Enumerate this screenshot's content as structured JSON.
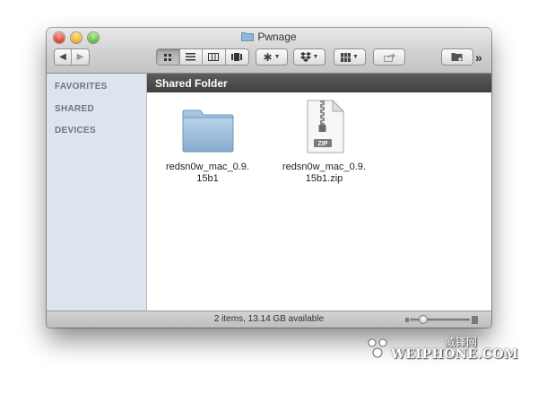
{
  "window": {
    "title": "Pwnage"
  },
  "toolbar": {
    "back_icon": "chevron-left-icon",
    "forward_icon": "chevron-right-icon",
    "view_modes": [
      "icon-view",
      "list-view",
      "column-view",
      "coverflow-view"
    ],
    "active_view": "icon-view",
    "action_icon": "gear-icon",
    "dropbox_icon": "dropbox-icon",
    "arrange_icon": "grid-icon",
    "share_icon": "share-icon",
    "new_folder_icon": "new-folder-icon",
    "overflow": "»"
  },
  "sidebar": {
    "sections": [
      {
        "label": "FAVORITES"
      },
      {
        "label": "SHARED"
      },
      {
        "label": "DEVICES"
      }
    ]
  },
  "pathbar": {
    "label": "Shared Folder"
  },
  "files": [
    {
      "name": "redsn0w_mac_0.9.\n15b1",
      "kind": "folder"
    },
    {
      "name": "redsn0w_mac_0.9.\n15b1.zip",
      "kind": "zip",
      "badge": "ZIP"
    }
  ],
  "status": {
    "text": "2 items, 13.14 GB available",
    "zoom_level": 0.15
  },
  "watermark": {
    "text": "WEIPHONE.COM",
    "cn": "威锋网"
  },
  "colors": {
    "sidebar_bg": "#dde4ee",
    "pathbar_bg": "#4a4a4a",
    "folder_blue": "#8fb6d8"
  }
}
